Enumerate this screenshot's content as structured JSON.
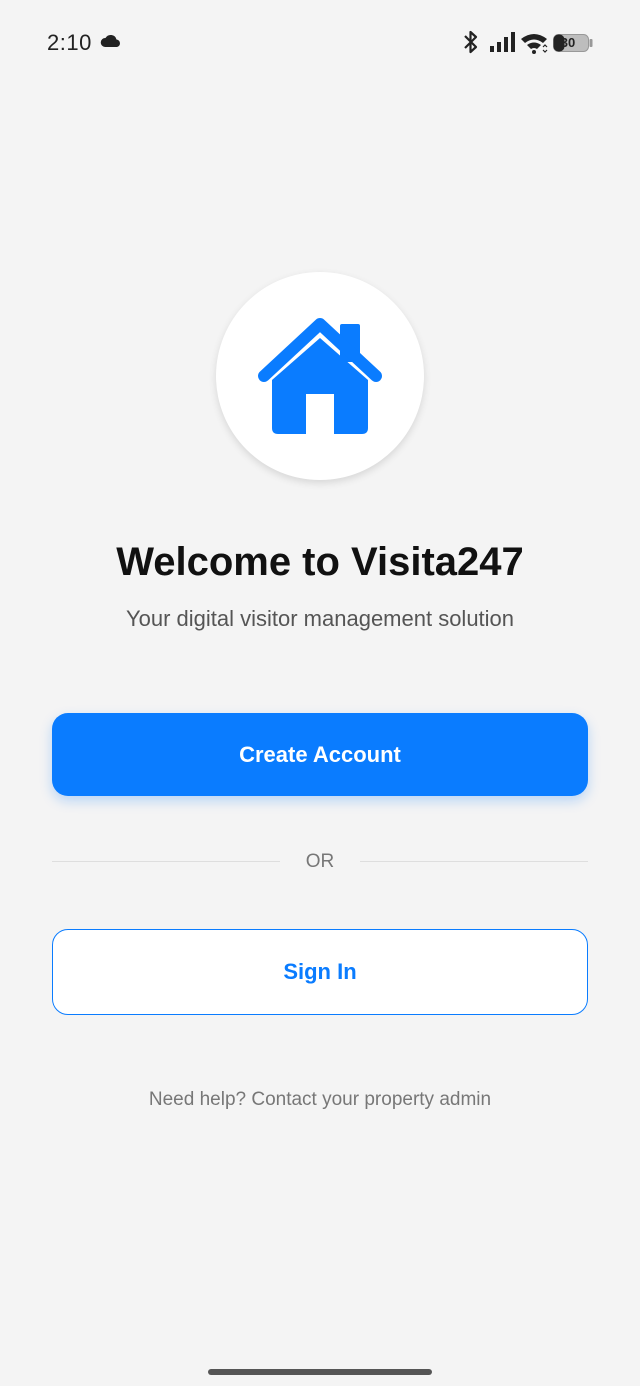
{
  "status_bar": {
    "time": "2:10",
    "battery": "30",
    "icons": [
      "cloud-icon",
      "bluetooth-icon",
      "signal-icon",
      "wifi-icon",
      "battery-icon"
    ]
  },
  "logo": {
    "icon": "house-icon",
    "color": "#0a7cff"
  },
  "welcome": {
    "title": "Welcome to Visita247",
    "subtitle": "Your digital visitor management solution"
  },
  "actions": {
    "create_account_label": "Create Account",
    "divider_label": "OR",
    "sign_in_label": "Sign In"
  },
  "help": {
    "text": "Need help? Contact your property admin"
  },
  "colors": {
    "primary": "#0a7cff",
    "background": "#f4f4f4"
  }
}
